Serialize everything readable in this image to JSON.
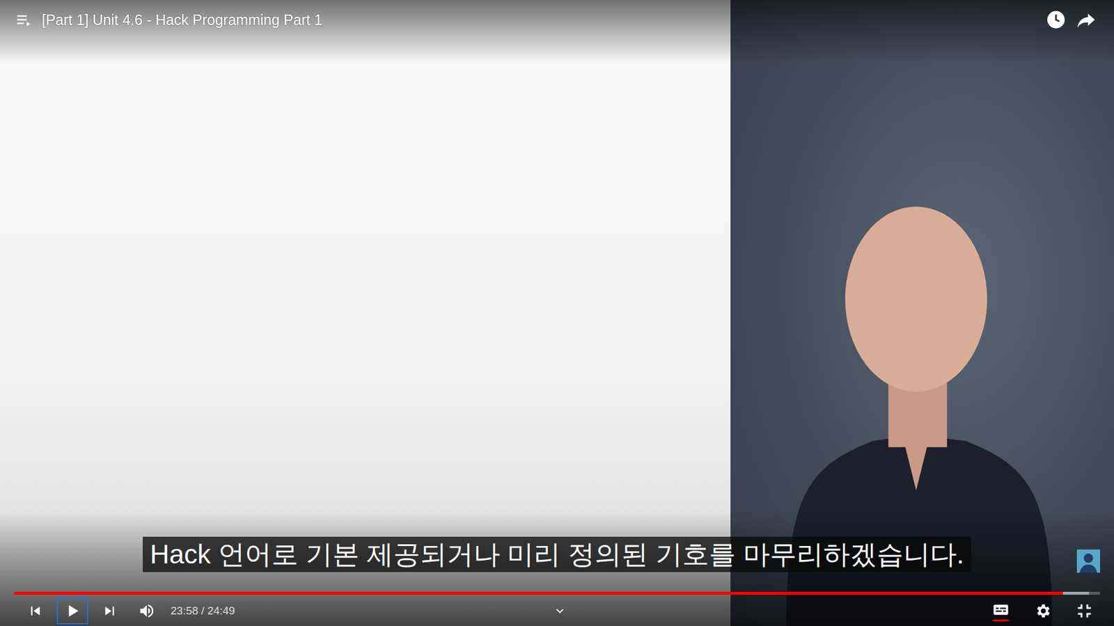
{
  "player": {
    "title": "[Part 1] Unit 4.6 - Hack Programming Part 1",
    "caption": "Hack 언어로 기본 제공되거나 미리 정의된 기호를 마무리하겠습니다.",
    "time": "23:58 / 24:49",
    "progress": {
      "level": 0.966,
      "buffered": 0.99
    },
    "playing": false,
    "subtitles_on": true
  }
}
